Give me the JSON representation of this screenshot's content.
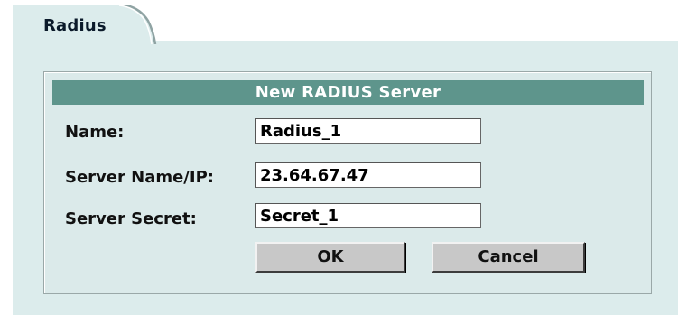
{
  "tab": {
    "label": "Radius"
  },
  "dialog": {
    "title": "New RADIUS Server",
    "fields": [
      {
        "label": "Name:",
        "value": "Radius_1"
      },
      {
        "label": "Server Name/IP:",
        "value": "23.64.67.47"
      },
      {
        "label": "Server Secret:",
        "value": "Secret_1"
      }
    ],
    "ok_label": "OK",
    "cancel_label": "Cancel"
  },
  "colors": {
    "panel_background": "#dcecec",
    "header_background": "#5e958c",
    "header_text": "#ffffff",
    "button_face": "#c8c8c8"
  }
}
